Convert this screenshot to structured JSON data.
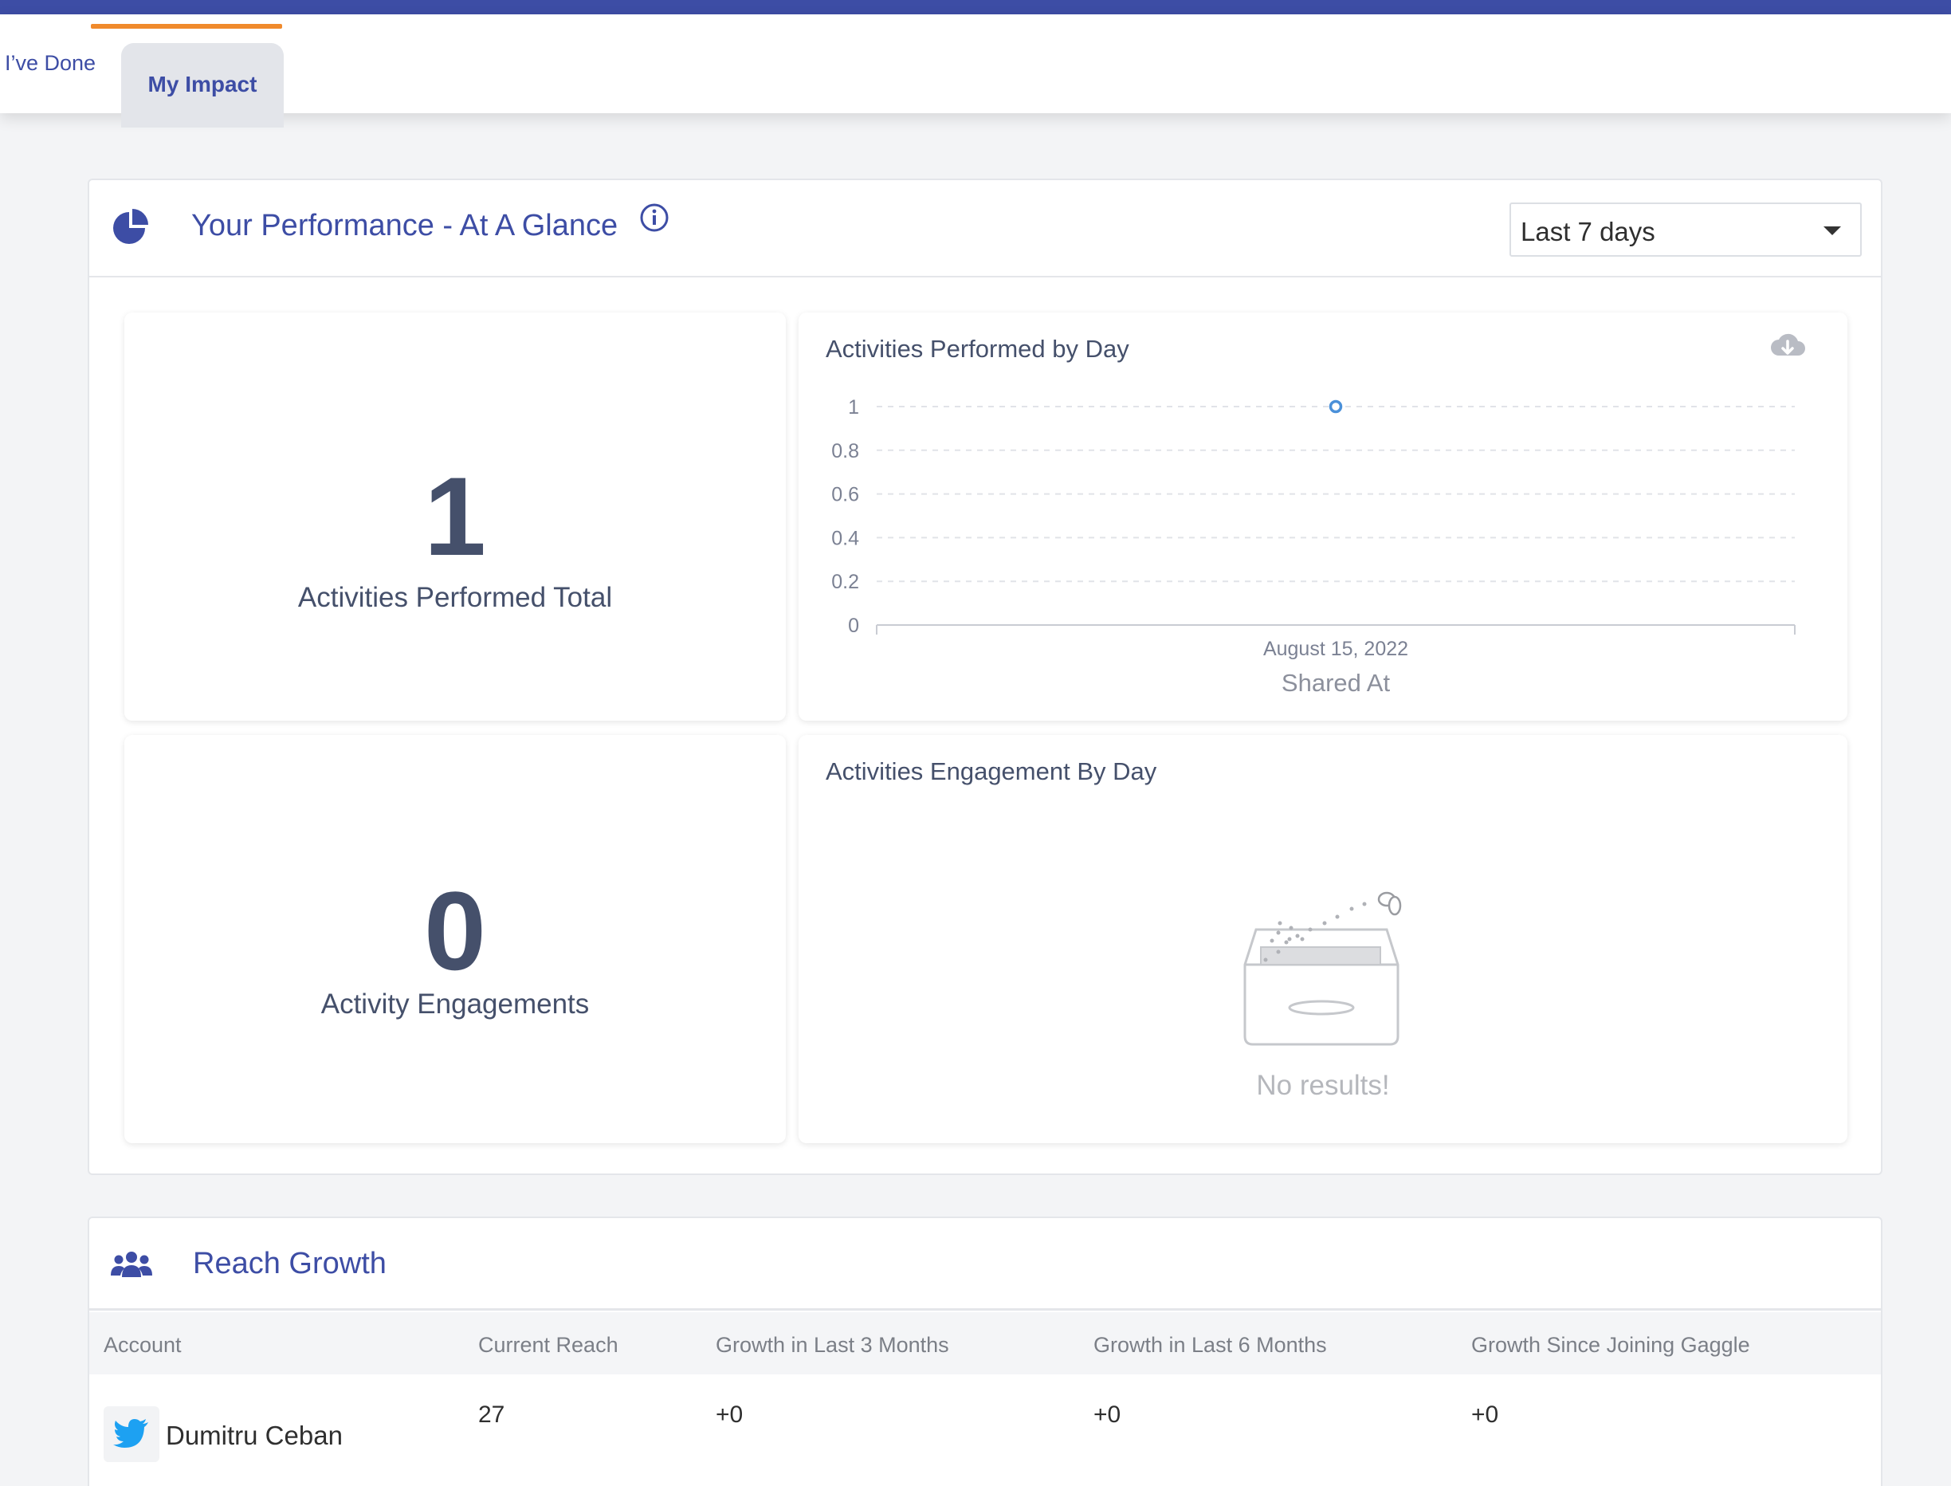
{
  "tabs": {
    "previous_label": "I’ve Done",
    "active_label": "My Impact"
  },
  "performance": {
    "title": "Your Performance - At A Glance",
    "period_select": {
      "selected": "Last 7 days"
    },
    "activities_total": {
      "value": "1",
      "label": "Activities Performed Total"
    },
    "engagements": {
      "value": "0",
      "label": "Activity Engagements"
    },
    "activities_by_day": {
      "title": "Activities Performed by Day",
      "y_ticks": [
        "0",
        "0.2",
        "0.4",
        "0.6",
        "0.8",
        "1"
      ],
      "x_tick": "August 15, 2022",
      "x_title": "Shared At"
    },
    "engagement_by_day": {
      "title": "Activities Engagement By Day",
      "empty_text": "No results!"
    }
  },
  "chart_data": {
    "type": "line",
    "title": "Activities Performed by Day",
    "xlabel": "Shared At",
    "ylabel": "",
    "x": [
      "August 15, 2022"
    ],
    "series": [
      {
        "values": [
          1
        ]
      }
    ],
    "ylim": [
      0,
      1
    ],
    "grid": true,
    "colors": {
      "point": "#4a90d9"
    }
  },
  "reach": {
    "title": "Reach Growth",
    "columns": [
      "Account",
      "Current Reach",
      "Growth in Last 3 Months",
      "Growth in Last 6 Months",
      "Growth Since Joining Gaggle"
    ],
    "rows": [
      {
        "account": "Dumitru Ceban",
        "network_icon": "twitter-icon",
        "current_reach": "27",
        "growth_3m": "+0",
        "growth_6m": "+0",
        "growth_since_joining": "+0"
      }
    ]
  },
  "colors": {
    "brand": "#3d4da5",
    "accent": "#f08a2c",
    "twitter": "#1da1f2"
  }
}
